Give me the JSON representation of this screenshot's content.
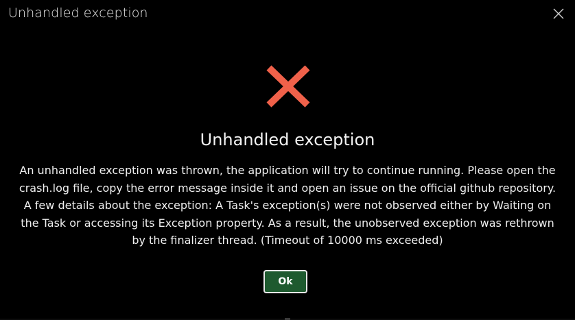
{
  "window": {
    "title": "Unhandled exception"
  },
  "dialog": {
    "heading": "Unhandled exception",
    "message": "An unhandled exception was thrown, the application will try to continue running. Please open the crash.log file, copy the error message inside it and open an issue on the official github repository. A few details about the exception: A Task's exception(s) were not observed either by Waiting on the Task or accessing its Exception property. As a result, the unobserved exception was rethrown by the finalizer thread. (Timeout of 10000 ms exceeded)",
    "icon": "error-x-icon",
    "ok_label": "Ok"
  },
  "colors": {
    "background": "#000000",
    "error_icon": "#f0614a",
    "ok_button_bg": "#1e5a2f",
    "ok_button_border": "#e9e9e9",
    "text": "#f0f0f0"
  }
}
